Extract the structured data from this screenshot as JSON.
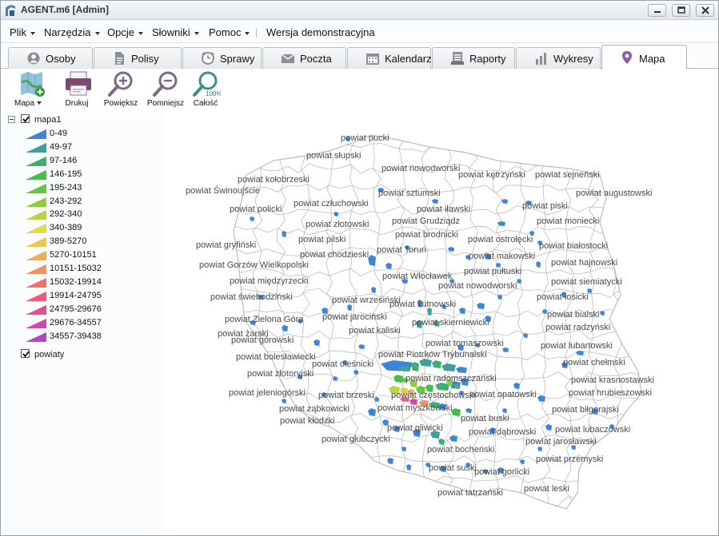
{
  "window": {
    "title": "AGENT.m6 [Admin]"
  },
  "menu": {
    "items": [
      "Plik",
      "Narzędzia",
      "Opcje",
      "Słowniki",
      "Pomoc"
    ],
    "demo_label": "Wersja demonstracyjna"
  },
  "tabs": [
    {
      "label": "Osoby",
      "icon": "person-icon",
      "active": false
    },
    {
      "label": "Polisy",
      "icon": "document-icon",
      "active": false
    },
    {
      "label": "Sprawy",
      "icon": "clock-icon",
      "active": false
    },
    {
      "label": "Poczta",
      "icon": "mail-icon",
      "active": false
    },
    {
      "label": "Kalendarz",
      "icon": "calendar-icon",
      "active": false
    },
    {
      "label": "Raporty",
      "icon": "report-icon",
      "active": false
    },
    {
      "label": "Wykresy",
      "icon": "bar-chart-icon",
      "active": false
    },
    {
      "label": "Mapa",
      "icon": "map-pin-icon",
      "active": true
    }
  ],
  "toolbar": {
    "map_label": "Mapa",
    "print_label": "Drukuj",
    "zoom_in_label": "Powiększ",
    "zoom_out_label": "Pomniejsz",
    "fit_label": "Całość",
    "fit_badge": "100%"
  },
  "layers": {
    "map_layer": {
      "name": "mapa1",
      "checked": true
    },
    "counties_layer": {
      "name": "powiaty",
      "checked": true
    },
    "legend": [
      {
        "range": "0-49",
        "color": "#3b86d8"
      },
      {
        "range": "49-97",
        "color": "#3f9f9c"
      },
      {
        "range": "97-146",
        "color": "#3fae6e"
      },
      {
        "range": "146-195",
        "color": "#47bd4a"
      },
      {
        "range": "195-243",
        "color": "#62c641"
      },
      {
        "range": "243-292",
        "color": "#8bce40"
      },
      {
        "range": "292-340",
        "color": "#b7d642"
      },
      {
        "range": "340-389",
        "color": "#dcdc46"
      },
      {
        "range": "389-5270",
        "color": "#ecc650"
      },
      {
        "range": "5270-10151",
        "color": "#f0ad58"
      },
      {
        "range": "10151-15032",
        "color": "#f39060"
      },
      {
        "range": "15032-19914",
        "color": "#f2716a"
      },
      {
        "range": "19914-24795",
        "color": "#ee5a78"
      },
      {
        "range": "24795-29676",
        "color": "#e0508f"
      },
      {
        "range": "29676-34557",
        "color": "#cf4aa8"
      },
      {
        "range": "34557-39438",
        "color": "#b246c8"
      }
    ]
  },
  "map": {
    "border_color": "#b9bcc0",
    "labels": [
      "powiat pucki",
      "powiat słupski",
      "powiat nowodworski",
      "powiat kołobrzeski",
      "powiat kętrzyński",
      "powiat sejneński",
      "powiat Świnoujście",
      "powiat sztumski",
      "powiat augustowski",
      "powiat człuchowski",
      "powiat iławski",
      "powiat piski",
      "powiat policki",
      "powiat złotowski",
      "powiat Grudziądz",
      "powiat moniecki",
      "powiat brodnicki",
      "powiat pilski",
      "powiat ostrołęcki",
      "powiat gryfiński",
      "powiat białostocki",
      "powiat Toruń",
      "powiat chodzieski",
      "powiat makowski",
      "powiat Gorzów Wielkopolski",
      "powiat hajnowski",
      "powiat pułtuski",
      "powiat międzyrzecki",
      "powiat Włocławek",
      "powiat siemiatycki",
      "powiat nowodworski",
      "powiat świebodziński",
      "powiat łosicki",
      "powiat wrzesiński",
      "powiat kutnowski",
      "powiat bialski",
      "powiat Zielona Góra",
      "powiat jarociński",
      "powiat skierniewicki",
      "powiat radzyński",
      "powiat żarski",
      "powiat kaliski",
      "powiat górowski",
      "powiat tomaszowski",
      "powiat lubartowski",
      "powiat Piotrków Trybunalski",
      "powiat bolesławiecki",
      "powiat oleśnicki",
      "powiat chełmski",
      "powiat złotoryjski",
      "powiat radomszczański",
      "powiat krasnostawski",
      "powiat jeleniogórski",
      "powiat brzeski",
      "powiat częstochowski",
      "powiat opatowski",
      "powiat hrubieszowski",
      "powiat ząbkowicki",
      "powiat myszkowski",
      "powiat biłgorajski",
      "powiat kłodzki",
      "powiat buski",
      "powiat gliwicki",
      "powiat lubaczowski",
      "powiat głubczycki",
      "powiat dąbrowski",
      "powiat jarosławski",
      "powiat bocheński",
      "powiat przemyski",
      "powiat suski",
      "powiat gorlicki",
      "powiat leski",
      "powiat tatrzański"
    ]
  }
}
